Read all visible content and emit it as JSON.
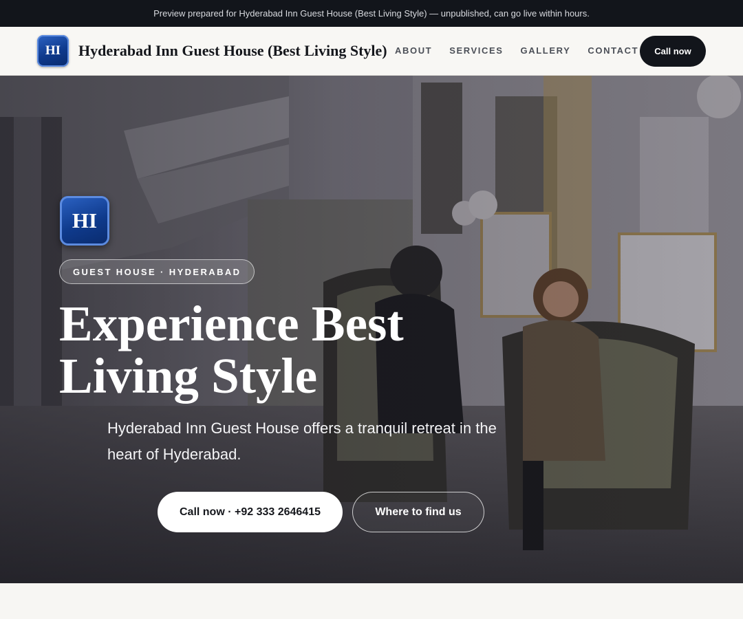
{
  "banner": {
    "text": "Preview prepared for Hyderabad Inn Guest House (Best Living Style) — unpublished, can go live within hours."
  },
  "nav": {
    "logo_initials": "HI",
    "brand_name": "Hyderabad Inn Guest House (Best Living Style)",
    "links": [
      {
        "label": "ABOUT"
      },
      {
        "label": "SERVICES"
      },
      {
        "label": "GALLERY"
      },
      {
        "label": "CONTACT"
      }
    ],
    "call_label": "Call now"
  },
  "hero": {
    "logo_initials": "HI",
    "eyebrow": "GUEST HOUSE · HYDERABAD",
    "headline": "Experience Best Living Style",
    "subtitle": "Hyderabad Inn Guest House offers a tranquil retreat in the heart of Hyderabad.",
    "primary_button": "Call now · +92 333 2646415",
    "secondary_button": "Where to find us",
    "image_icon": "hotel-lobby-photo"
  },
  "colors": {
    "banner_bg": "#12151b",
    "brand_blue": "#0f3a8c",
    "dark_button": "#12151b",
    "page_bg": "#f7f6f3"
  }
}
